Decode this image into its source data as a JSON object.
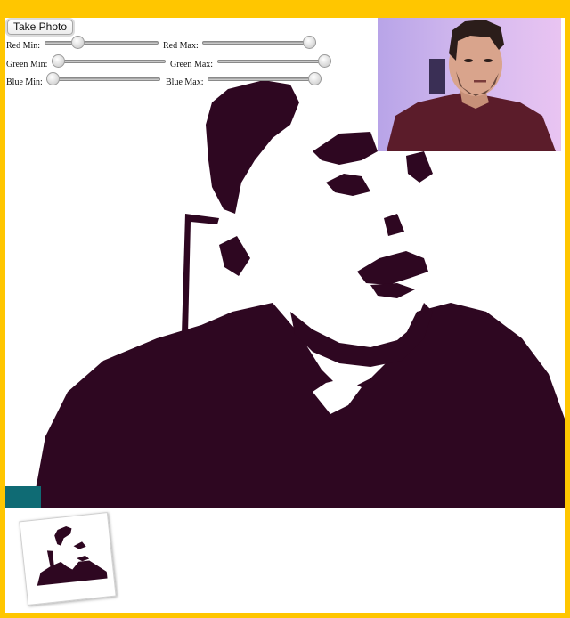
{
  "controls": {
    "take_photo_label": "Take Photo",
    "sliders": [
      {
        "label": "Red Min:",
        "value": 30
      },
      {
        "label": "Red Max:",
        "value": 220
      },
      {
        "label": "Green Min:",
        "value": 0
      },
      {
        "label": "Green Max:",
        "value": 255
      },
      {
        "label": "Blue Min:",
        "value": 0
      },
      {
        "label": "Blue Max:",
        "value": 255
      }
    ]
  },
  "colors": {
    "frame": "#FFC600",
    "filtered_dark": "#2E0721",
    "background": "#FFFFFF"
  },
  "panels": {
    "filtered_view": "filtered-video",
    "live_preview": "webcam-preview",
    "snapshot": "captured-photo"
  }
}
